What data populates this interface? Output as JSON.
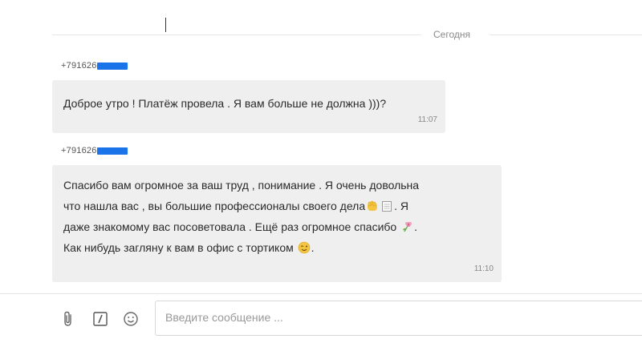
{
  "date_separator": "Сегодня",
  "messages": [
    {
      "sender": "+791626",
      "text": "Доброе утро ! Платёж провела . Я вам больше не должна )))?",
      "time": "11:07"
    },
    {
      "sender": "+791626",
      "lines": [
        "Спасибо вам огромное за ваш труд , понимание . Я очень довольна",
        "что нашла вас , вы большие профессионалы своего дела",
        ". Я",
        "даже знакомому вас посоветовала . Ещё раз огромное спасибо",
        ".",
        "Как нибудь загляну к вам в офис с тортиком",
        "."
      ],
      "emoji_icons": [
        "fist-emoji",
        "notepad-emoji",
        "flower-emoji",
        "wink-emoji"
      ],
      "time": "11:10"
    }
  ],
  "composer": {
    "placeholder": "Введите сообщение ...",
    "icons": [
      "paperclip-icon",
      "format-icon",
      "smiley-icon"
    ]
  },
  "colors": {
    "bubble_bg": "#efefef",
    "redaction": "#1a73e8",
    "emoji_yellow": "#f4c542"
  }
}
